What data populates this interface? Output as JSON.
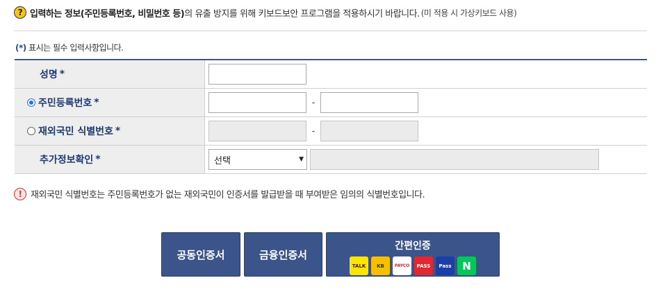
{
  "notice": {
    "icon": "question-icon",
    "bold_text": "입력하는 정보(주민등록번호, 비밀번호 등)",
    "text": "의 유출 방지를 위해 키보드보안 프로그램을 적용하시기 바랍니다.",
    "note": "(미 적용 시 가상키보드 사용)"
  },
  "required_note": {
    "star": "(*)",
    "text": " 표시는 필수 입력사항입니다."
  },
  "form": {
    "name_label": "성명",
    "rrn_label": "주민등록번호",
    "foreign_label": "재외국민 식별번호",
    "extra_label": "추가정보확인",
    "star": "*",
    "dash": "-",
    "rrn_selected": true,
    "select_value": "선택"
  },
  "warning": {
    "icon": "exclamation-icon",
    "text": "재외국민 식별번호는 주민등록번호가 없는 재외국민이 인증서를 발급받을 때 부여받은 임의의 식별번호입니다."
  },
  "buttons": {
    "joint_cert": "공동인증서",
    "financial_cert": "금융인증서",
    "simple_auth": "간편인증",
    "simple_logos": {
      "kakao": "TALK",
      "kb": "KB",
      "payco": "PAYCO",
      "pass": "PASS",
      "samsung_pass": "Pass",
      "naver": "N"
    }
  },
  "colors": {
    "accent": "#3b548a",
    "label_text": "#1e3a6e",
    "label_bg": "#eeeeee",
    "radio_selected": "#1a73e8",
    "warning": "#cc3333"
  }
}
